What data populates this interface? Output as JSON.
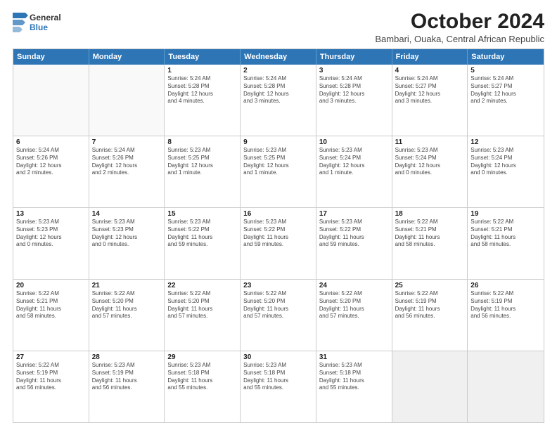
{
  "logo": {
    "line1": "General",
    "line2": "Blue"
  },
  "title": "October 2024",
  "subtitle": "Bambari, Ouaka, Central African Republic",
  "header": {
    "days": [
      "Sunday",
      "Monday",
      "Tuesday",
      "Wednesday",
      "Thursday",
      "Friday",
      "Saturday"
    ]
  },
  "rows": [
    [
      {
        "num": "",
        "lines": [],
        "empty": true
      },
      {
        "num": "",
        "lines": [],
        "empty": true
      },
      {
        "num": "1",
        "lines": [
          "Sunrise: 5:24 AM",
          "Sunset: 5:28 PM",
          "Daylight: 12 hours",
          "and 4 minutes."
        ]
      },
      {
        "num": "2",
        "lines": [
          "Sunrise: 5:24 AM",
          "Sunset: 5:28 PM",
          "Daylight: 12 hours",
          "and 3 minutes."
        ]
      },
      {
        "num": "3",
        "lines": [
          "Sunrise: 5:24 AM",
          "Sunset: 5:28 PM",
          "Daylight: 12 hours",
          "and 3 minutes."
        ]
      },
      {
        "num": "4",
        "lines": [
          "Sunrise: 5:24 AM",
          "Sunset: 5:27 PM",
          "Daylight: 12 hours",
          "and 3 minutes."
        ]
      },
      {
        "num": "5",
        "lines": [
          "Sunrise: 5:24 AM",
          "Sunset: 5:27 PM",
          "Daylight: 12 hours",
          "and 2 minutes."
        ]
      }
    ],
    [
      {
        "num": "6",
        "lines": [
          "Sunrise: 5:24 AM",
          "Sunset: 5:26 PM",
          "Daylight: 12 hours",
          "and 2 minutes."
        ]
      },
      {
        "num": "7",
        "lines": [
          "Sunrise: 5:24 AM",
          "Sunset: 5:26 PM",
          "Daylight: 12 hours",
          "and 2 minutes."
        ]
      },
      {
        "num": "8",
        "lines": [
          "Sunrise: 5:23 AM",
          "Sunset: 5:25 PM",
          "Daylight: 12 hours",
          "and 1 minute."
        ]
      },
      {
        "num": "9",
        "lines": [
          "Sunrise: 5:23 AM",
          "Sunset: 5:25 PM",
          "Daylight: 12 hours",
          "and 1 minute."
        ]
      },
      {
        "num": "10",
        "lines": [
          "Sunrise: 5:23 AM",
          "Sunset: 5:24 PM",
          "Daylight: 12 hours",
          "and 1 minute."
        ]
      },
      {
        "num": "11",
        "lines": [
          "Sunrise: 5:23 AM",
          "Sunset: 5:24 PM",
          "Daylight: 12 hours",
          "and 0 minutes."
        ]
      },
      {
        "num": "12",
        "lines": [
          "Sunrise: 5:23 AM",
          "Sunset: 5:24 PM",
          "Daylight: 12 hours",
          "and 0 minutes."
        ]
      }
    ],
    [
      {
        "num": "13",
        "lines": [
          "Sunrise: 5:23 AM",
          "Sunset: 5:23 PM",
          "Daylight: 12 hours",
          "and 0 minutes."
        ]
      },
      {
        "num": "14",
        "lines": [
          "Sunrise: 5:23 AM",
          "Sunset: 5:23 PM",
          "Daylight: 12 hours",
          "and 0 minutes."
        ]
      },
      {
        "num": "15",
        "lines": [
          "Sunrise: 5:23 AM",
          "Sunset: 5:22 PM",
          "Daylight: 11 hours",
          "and 59 minutes."
        ]
      },
      {
        "num": "16",
        "lines": [
          "Sunrise: 5:23 AM",
          "Sunset: 5:22 PM",
          "Daylight: 11 hours",
          "and 59 minutes."
        ]
      },
      {
        "num": "17",
        "lines": [
          "Sunrise: 5:23 AM",
          "Sunset: 5:22 PM",
          "Daylight: 11 hours",
          "and 59 minutes."
        ]
      },
      {
        "num": "18",
        "lines": [
          "Sunrise: 5:22 AM",
          "Sunset: 5:21 PM",
          "Daylight: 11 hours",
          "and 58 minutes."
        ]
      },
      {
        "num": "19",
        "lines": [
          "Sunrise: 5:22 AM",
          "Sunset: 5:21 PM",
          "Daylight: 11 hours",
          "and 58 minutes."
        ]
      }
    ],
    [
      {
        "num": "20",
        "lines": [
          "Sunrise: 5:22 AM",
          "Sunset: 5:21 PM",
          "Daylight: 11 hours",
          "and 58 minutes."
        ]
      },
      {
        "num": "21",
        "lines": [
          "Sunrise: 5:22 AM",
          "Sunset: 5:20 PM",
          "Daylight: 11 hours",
          "and 57 minutes."
        ]
      },
      {
        "num": "22",
        "lines": [
          "Sunrise: 5:22 AM",
          "Sunset: 5:20 PM",
          "Daylight: 11 hours",
          "and 57 minutes."
        ]
      },
      {
        "num": "23",
        "lines": [
          "Sunrise: 5:22 AM",
          "Sunset: 5:20 PM",
          "Daylight: 11 hours",
          "and 57 minutes."
        ]
      },
      {
        "num": "24",
        "lines": [
          "Sunrise: 5:22 AM",
          "Sunset: 5:20 PM",
          "Daylight: 11 hours",
          "and 57 minutes."
        ]
      },
      {
        "num": "25",
        "lines": [
          "Sunrise: 5:22 AM",
          "Sunset: 5:19 PM",
          "Daylight: 11 hours",
          "and 56 minutes."
        ]
      },
      {
        "num": "26",
        "lines": [
          "Sunrise: 5:22 AM",
          "Sunset: 5:19 PM",
          "Daylight: 11 hours",
          "and 56 minutes."
        ]
      }
    ],
    [
      {
        "num": "27",
        "lines": [
          "Sunrise: 5:22 AM",
          "Sunset: 5:19 PM",
          "Daylight: 11 hours",
          "and 56 minutes."
        ]
      },
      {
        "num": "28",
        "lines": [
          "Sunrise: 5:23 AM",
          "Sunset: 5:19 PM",
          "Daylight: 11 hours",
          "and 56 minutes."
        ]
      },
      {
        "num": "29",
        "lines": [
          "Sunrise: 5:23 AM",
          "Sunset: 5:18 PM",
          "Daylight: 11 hours",
          "and 55 minutes."
        ]
      },
      {
        "num": "30",
        "lines": [
          "Sunrise: 5:23 AM",
          "Sunset: 5:18 PM",
          "Daylight: 11 hours",
          "and 55 minutes."
        ]
      },
      {
        "num": "31",
        "lines": [
          "Sunrise: 5:23 AM",
          "Sunset: 5:18 PM",
          "Daylight: 11 hours",
          "and 55 minutes."
        ]
      },
      {
        "num": "",
        "lines": [],
        "empty": true,
        "shaded": true
      },
      {
        "num": "",
        "lines": [],
        "empty": true,
        "shaded": true
      }
    ]
  ]
}
